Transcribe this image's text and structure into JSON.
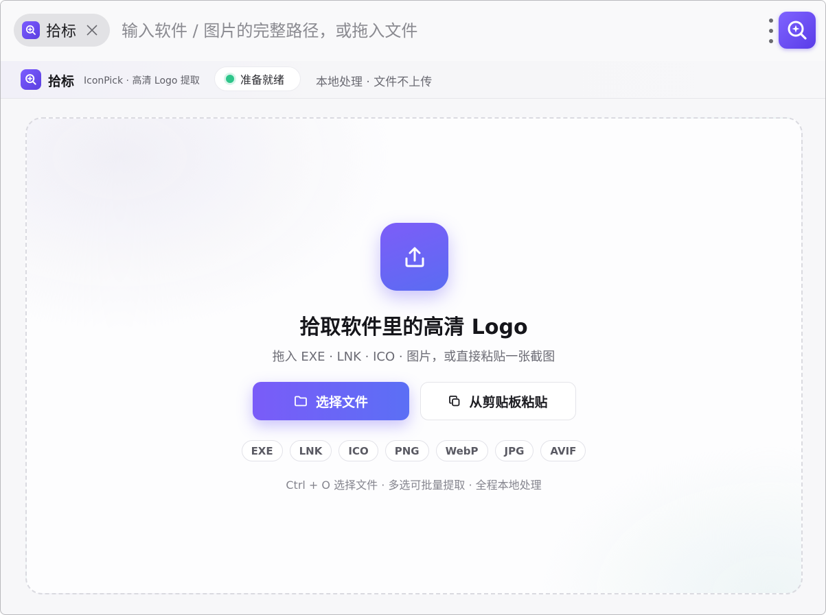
{
  "searchbar": {
    "tag_label": "拾标",
    "placeholder": "输入软件 / 图片的完整路径，或拖入文件",
    "icons": [
      "magnifier-plus-icon",
      "close-icon",
      "more-vertical-icon",
      "app-launcher-icon"
    ]
  },
  "appbar": {
    "name": "拾标",
    "subtitle": "IconPick · 高清 Logo 提取",
    "status": "准备就绪",
    "status_color": "#2ec58a",
    "privacy_note": "本地处理 · 文件不上传"
  },
  "main": {
    "title": "拾取软件里的高清 Logo",
    "subtitle": "拖入 EXE · LNK · ICO · 图片，或直接粘贴一张截图",
    "primary_button": "选择文件",
    "secondary_button": "从剪贴板粘贴",
    "formats": [
      "EXE",
      "LNK",
      "ICO",
      "PNG",
      "WebP",
      "JPG",
      "AVIF"
    ],
    "hint": "Ctrl + O 选择文件 · 多选可批量提取 · 全程本地处理"
  },
  "colors": {
    "accent_start": "#7a5cf8",
    "accent_end": "#5b6ff5"
  }
}
